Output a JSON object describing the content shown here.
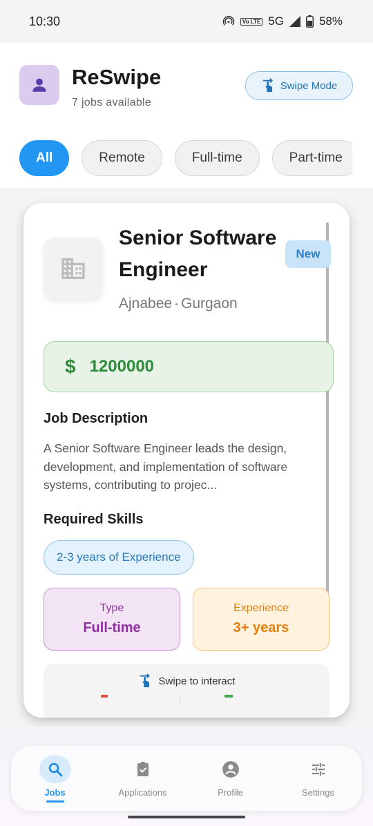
{
  "status_bar": {
    "time": "10:30",
    "network": "5G",
    "lte": "Vo LTE",
    "battery": "58%"
  },
  "header": {
    "title": "ReSwipe",
    "subtitle": "7 jobs available",
    "swipe_mode_label": "Swipe Mode",
    "filters": [
      "All",
      "Remote",
      "Full-time",
      "Part-time"
    ]
  },
  "job": {
    "title": "Senior Software Engineer",
    "badge": "New",
    "company": "Ajnabee",
    "location": "Gurgaon",
    "salary_symbol": "$",
    "salary": "1200000",
    "description_heading": "Job Description",
    "description": "A Senior Software Engineer leads the design, development, and implementation of software systems, contributing to projec...",
    "skills_heading": "Required Skills",
    "skills": [
      "2-3 years of Experience"
    ],
    "type_label": "Type",
    "type_value": "Full-time",
    "experience_label": "Experience",
    "experience_value": "3+ years",
    "swipe_hint": "Swipe to interact"
  },
  "nav": {
    "items": [
      {
        "label": "Jobs",
        "icon": "search-icon",
        "active": true
      },
      {
        "label": "Applications",
        "icon": "clipboard-check-icon",
        "active": false
      },
      {
        "label": "Profile",
        "icon": "account-circle-icon",
        "active": false
      },
      {
        "label": "Settings",
        "icon": "tune-icon",
        "active": false
      }
    ]
  },
  "colors": {
    "accent": "#2196f3",
    "salary": "#2e8b3a",
    "type": "#8e2fa0",
    "experience": "#e07f10"
  }
}
